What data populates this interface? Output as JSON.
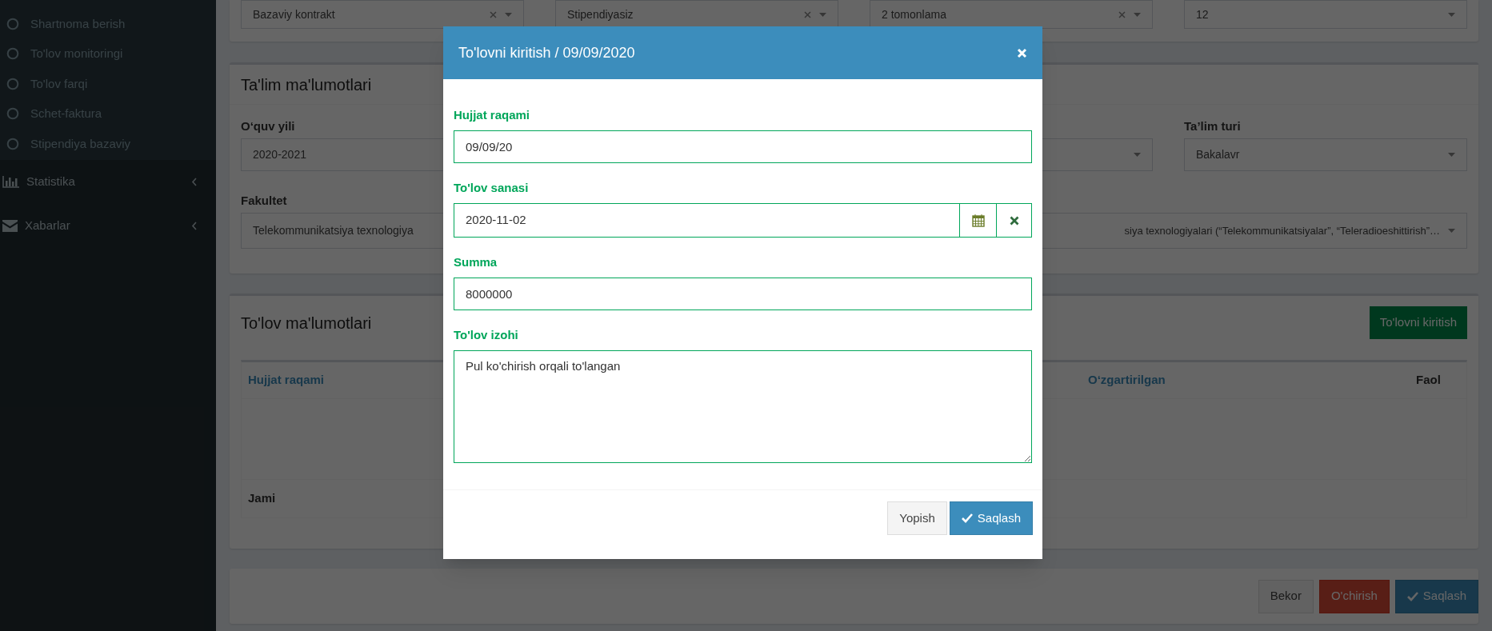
{
  "sidebar": {
    "submenu": [
      {
        "label": "Shartnoma berish"
      },
      {
        "label": "To'lov monitoringi"
      },
      {
        "label": "To'lov farqi"
      },
      {
        "label": "Schet-faktura"
      },
      {
        "label": "Stipendiya bazaviy"
      }
    ],
    "items": [
      {
        "label": "Statistika",
        "expanded": false
      },
      {
        "label": "Xabarlar",
        "expanded": false
      }
    ]
  },
  "contract_box": {
    "selects": [
      {
        "value": "Bazaviy kontrakt",
        "clearable": true
      },
      {
        "value": "Stipendiyasiz",
        "clearable": true
      },
      {
        "value": "2 tomonlama",
        "clearable": true
      },
      {
        "value": "12",
        "clearable": false
      }
    ]
  },
  "education": {
    "title": "Ta'lim ma'lumotlari",
    "study_year": {
      "label": "O‘quv yili",
      "value": "2020-2021"
    },
    "education_type": {
      "label": "Ta’lim turi",
      "value": "Bakalavr"
    },
    "faculty": {
      "label": "Fakultet",
      "value": "Telekommunikatsiya texnologiya"
    },
    "field_4": {
      "value": "siya texnologiyalari (“Telekommunikatsiyalar”, “Teleradioeshittirish”…"
    }
  },
  "payments": {
    "title": "To'lov ma'lumotlari",
    "add_button": "To'lovni kiritish",
    "table": {
      "columns": [
        "Hujjat raqami",
        "O‘zgartirilgan",
        "Faol"
      ],
      "footer": "Jami"
    }
  },
  "actions": [
    {
      "label": "Bekor",
      "kind": "default"
    },
    {
      "label": "O'chirish",
      "kind": "danger"
    },
    {
      "label": "Saqlash",
      "kind": "primary"
    }
  ],
  "modal": {
    "title": "To'lovni kiritish / 09/09/2020",
    "fields": [
      {
        "label": "Hujjat raqami",
        "value": "09/09/20",
        "kind": "text"
      },
      {
        "label": "To'lov sanasi",
        "value": "2020-11-02",
        "kind": "date"
      },
      {
        "label": "Summa",
        "value": "8000000",
        "kind": "text"
      },
      {
        "label": "To'lov izohi",
        "value": "Pul ko'chirish orqali to'langan",
        "kind": "textarea"
      }
    ],
    "buttons": [
      {
        "label": "Yopish",
        "kind": "default"
      },
      {
        "label": "Saqlash",
        "kind": "primary"
      }
    ]
  }
}
